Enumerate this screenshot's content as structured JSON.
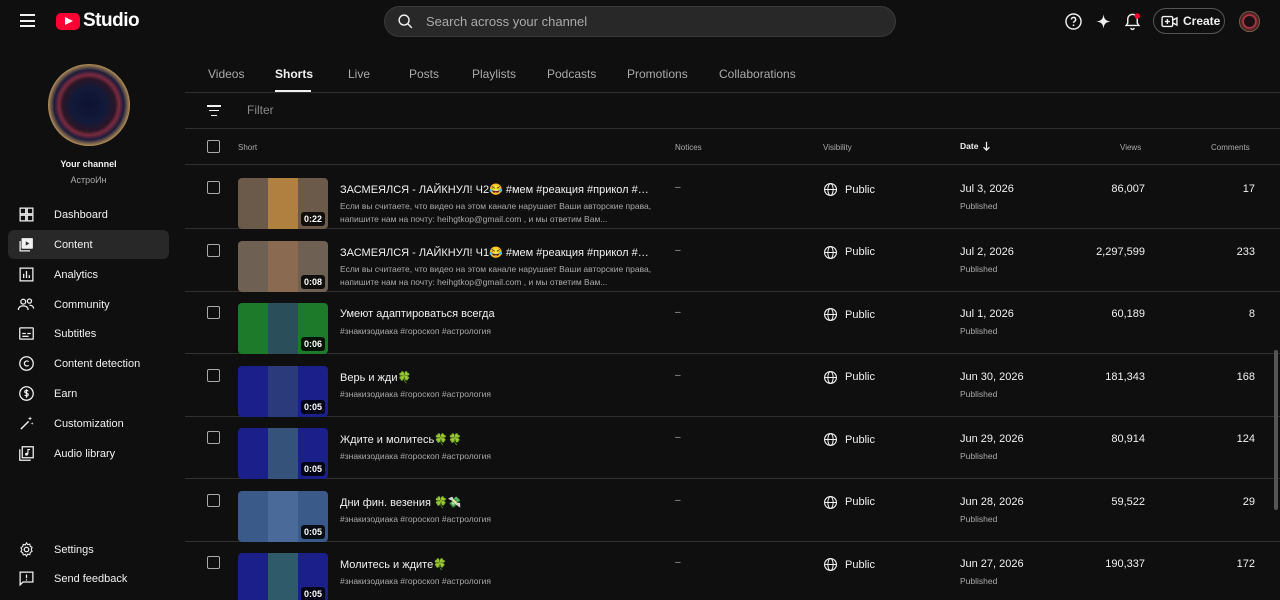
{
  "header": {
    "logo_text": "Studio",
    "search_placeholder": "Search across your channel",
    "create_label": "Create"
  },
  "sidebar": {
    "channel_title": "Your channel",
    "channel_name": "АстроИн",
    "items": [
      {
        "label": "Dashboard",
        "icon": "dashboard-icon"
      },
      {
        "label": "Content",
        "icon": "content-icon"
      },
      {
        "label": "Analytics",
        "icon": "analytics-icon"
      },
      {
        "label": "Community",
        "icon": "community-icon"
      },
      {
        "label": "Subtitles",
        "icon": "subtitles-icon"
      },
      {
        "label": "Content detection",
        "icon": "copyright-icon"
      },
      {
        "label": "Earn",
        "icon": "dollar-icon"
      },
      {
        "label": "Customization",
        "icon": "magic-wand-icon"
      },
      {
        "label": "Audio library",
        "icon": "audio-library-icon"
      }
    ],
    "bottom_items": [
      {
        "label": "Settings",
        "icon": "gear-icon"
      },
      {
        "label": "Send feedback",
        "icon": "feedback-icon"
      }
    ]
  },
  "tabs": [
    "Videos",
    "Shorts",
    "Live",
    "Posts",
    "Playlists",
    "Podcasts",
    "Promotions",
    "Collaborations"
  ],
  "active_tab": "Shorts",
  "filter_placeholder": "Filter",
  "columns": {
    "short": "Short",
    "notices": "Notices",
    "visibility": "Visibility",
    "date": "Date",
    "views": "Views",
    "comments": "Comments"
  },
  "rows": [
    {
      "title": "ЗАСМЕЯЛСЯ - ЛАЙКНУЛ! Ч2😂 #мем #реакция #прикол #ме...",
      "description": "Если вы считаете, что видео на этом канале нарушает Ваши авторские права, напишите нам на почту: heihgtkop@gmail.com , и мы ответим Вам...",
      "duration": "0:22",
      "notice": "–",
      "visibility": "Public",
      "date": "Jul 3, 2026",
      "status": "Published",
      "views": "86,007",
      "comments": "17",
      "thumb_bg": "#6b5a4a",
      "thumb_inner": "#b08040"
    },
    {
      "title": "ЗАСМЕЯЛСЯ - ЛАЙКНУЛ! Ч1😂 #мем #реакция #прикол #ме...",
      "description": "Если вы считаете, что видео на этом канале нарушает Ваши авторские права, напишите нам на почту: heihgtkop@gmail.com , и мы ответим Вам...",
      "duration": "0:08",
      "notice": "–",
      "visibility": "Public",
      "date": "Jul 2, 2026",
      "status": "Published",
      "views": "2,297,599",
      "comments": "233",
      "thumb_bg": "#6e6052",
      "thumb_inner": "#8a6a50"
    },
    {
      "title": "Умеют адаптироваться всегда",
      "description": "#знакизодиака #гороскоп #астрология",
      "duration": "0:06",
      "notice": "–",
      "visibility": "Public",
      "date": "Jul 1, 2026",
      "status": "Published",
      "views": "60,189",
      "comments": "8",
      "thumb_bg": "#1d7a2a",
      "thumb_inner": "#2b4f5a"
    },
    {
      "title": "Верь и жди🍀",
      "description": "#знакизодиака #гороскоп #астрология",
      "duration": "0:05",
      "notice": "–",
      "visibility": "Public",
      "date": "Jun 30, 2026",
      "status": "Published",
      "views": "181,343",
      "comments": "168",
      "thumb_bg": "#1a1f8a",
      "thumb_inner": "#2a3a7a"
    },
    {
      "title": "Ждите и молитесь🍀🍀",
      "description": "#знакизодиака #гороскоп #астрология",
      "duration": "0:05",
      "notice": "–",
      "visibility": "Public",
      "date": "Jun 29, 2026",
      "status": "Published",
      "views": "80,914",
      "comments": "124",
      "thumb_bg": "#1a1f8a",
      "thumb_inner": "#34527a"
    },
    {
      "title": "Дни фин. везения 🍀💸",
      "description": "#знакизодиака #гороскоп #астрология",
      "duration": "0:05",
      "notice": "–",
      "visibility": "Public",
      "date": "Jun 28, 2026",
      "status": "Published",
      "views": "59,522",
      "comments": "29",
      "thumb_bg": "#3a5a8a",
      "thumb_inner": "#4a6a9a"
    },
    {
      "title": "Молитесь и ждите🍀",
      "description": "#знакизодиака #гороскоп #астрология",
      "duration": "0:05",
      "notice": "–",
      "visibility": "Public",
      "date": "Jun 27, 2026",
      "status": "Published",
      "views": "190,337",
      "comments": "172",
      "thumb_bg": "#1a1f8a",
      "thumb_inner": "#2f5a6a"
    }
  ],
  "colors": {
    "background": "#0f0f0f",
    "brand_red": "#ff0033",
    "text_primary": "#f1f1f1",
    "text_secondary": "#aaaaaa",
    "divider": "#303030"
  }
}
